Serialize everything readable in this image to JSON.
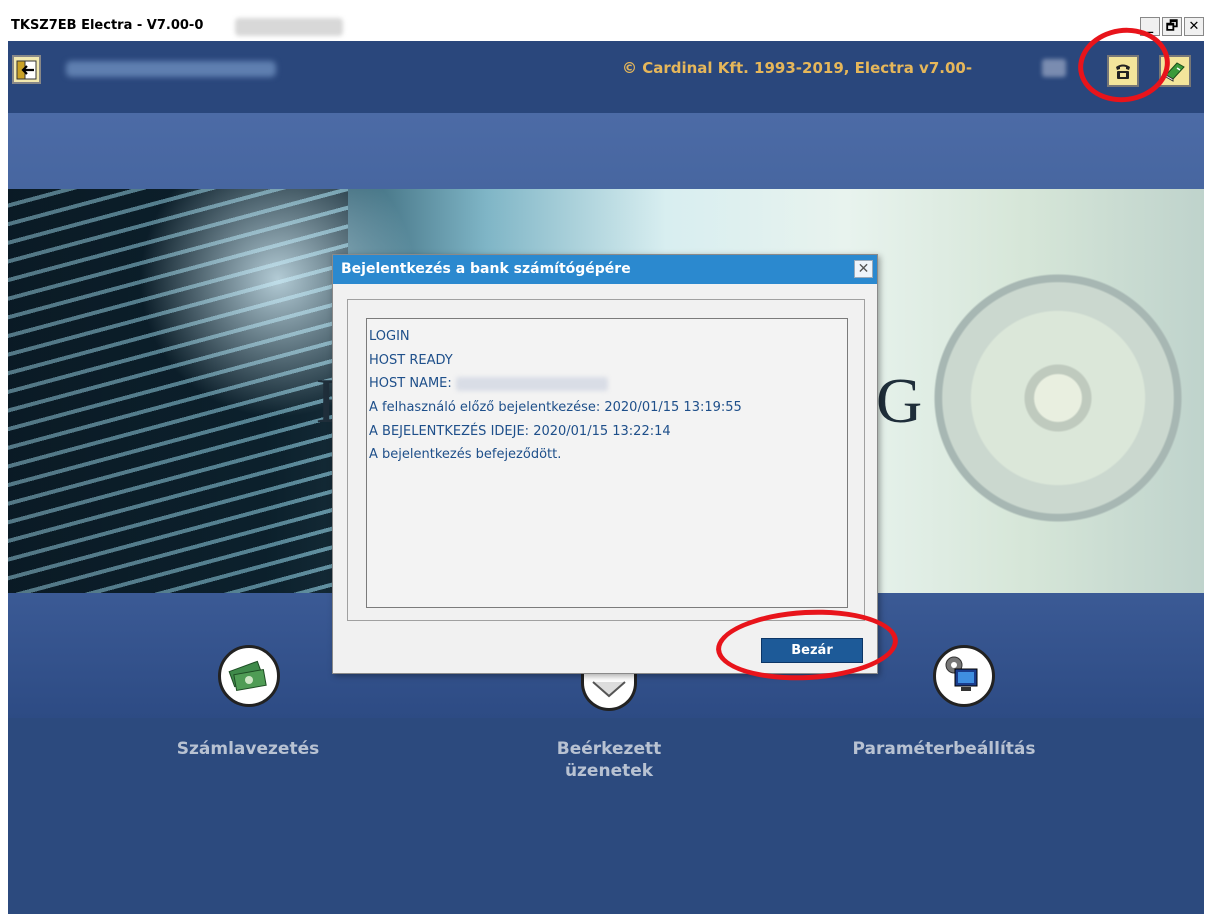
{
  "window": {
    "title": "TKSZ7EB Electra - V7.00-0",
    "minimize": "_",
    "restore": "🗗",
    "close": "✕"
  },
  "header": {
    "copyright": "© Cardinal Kft. 1993-2019, Electra v7.00-"
  },
  "banner": {
    "letter_left": "E",
    "letter_right": "G"
  },
  "nav": {
    "accounting_label": "Számlavezetés",
    "messages_label_line1": "Beérkezett",
    "messages_label_line2": "üzenetek",
    "settings_label": "Paraméterbeállítás"
  },
  "dialog": {
    "title": "Bejelentkezés a bank számítógépére",
    "close_symbol": "✕",
    "lines": [
      "LOGIN",
      "HOST READY",
      "HOST NAME:",
      "A felhasználó előző bejelentkezése: 2020/01/15 13:19:55",
      "A BEJELENTKEZÉS IDEJE: 2020/01/15 13:22:14",
      "A bejelentkezés befejeződött."
    ],
    "button_label": "Bezár"
  },
  "colors": {
    "app_bg": "#2c4a7e",
    "copyright_gold": "#e6b75a",
    "dialog_title": "#2b89cf",
    "log_text": "#1e4f8a",
    "annotation_red": "#e8141b"
  }
}
